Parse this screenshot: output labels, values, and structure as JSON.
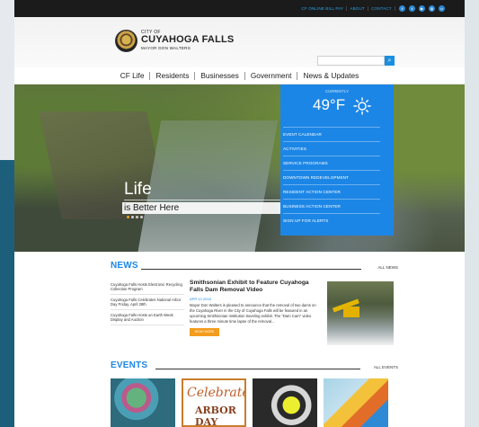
{
  "topbar": {
    "links": [
      "CF ONLINE BILL PAY",
      "ABOUT",
      "CONTACT"
    ],
    "social_icons": [
      "facebook-icon",
      "twitter-icon",
      "youtube-icon",
      "instagram-icon",
      "flickr-icon"
    ]
  },
  "header": {
    "city_of": "CITY OF",
    "city_name": "CUYAHOGA FALLS",
    "mayor": "MAYOR DON WALTERS",
    "search_placeholder": "",
    "search_icon": "search-icon"
  },
  "nav": {
    "items": [
      "CF Life",
      "Residents",
      "Businesses",
      "Government",
      "News & Updates"
    ]
  },
  "hero": {
    "headline": "Life",
    "tagline": "is Better Here",
    "slides": 4,
    "active_slide": 1
  },
  "weather": {
    "label": "CURRENTLY",
    "temperature": "49°F",
    "icon": "sun-icon"
  },
  "quick_links": [
    "EVENT CALENDAR",
    "ACTIVITIES",
    "SERVICE PROGRAMS",
    "DOWNTOWN REDEVELOPMENT",
    "RESIDENT ACTION CENTER",
    "BUSINESS ACTION CENTER",
    "SIGN UP FOR ALERTS"
  ],
  "news": {
    "title": "NEWS",
    "all_link": "ALL NEWS",
    "items": [
      "Cuyahoga Falls Hosts Electronic Recycling Collection Program",
      "Cuyahoga Falls Celebrates National Arbor Day Friday, April 29th",
      "Cuyahoga Falls Hosts an Earth Week Display and Auction"
    ],
    "feature": {
      "title": "Smithsonian Exhibit to Feature Cuyahoga Falls Dam Removal Video",
      "date": "APR 13 2016",
      "body": "Mayor Don Walters is pleased to announce that the removal of two dams on the Cuyahoga River in the City of Cuyahoga Falls will be featured in an upcoming Smithsonian Institution traveling exhibit. The \"Dam Cam\" video features a three minute time lapse of the removal...",
      "button": "READ MORE"
    }
  },
  "events": {
    "title": "EVENTS",
    "all_link": "ALL EVENTS",
    "arbor_script": "Celebrate",
    "arbor_big": "ARBOR DAY"
  }
}
